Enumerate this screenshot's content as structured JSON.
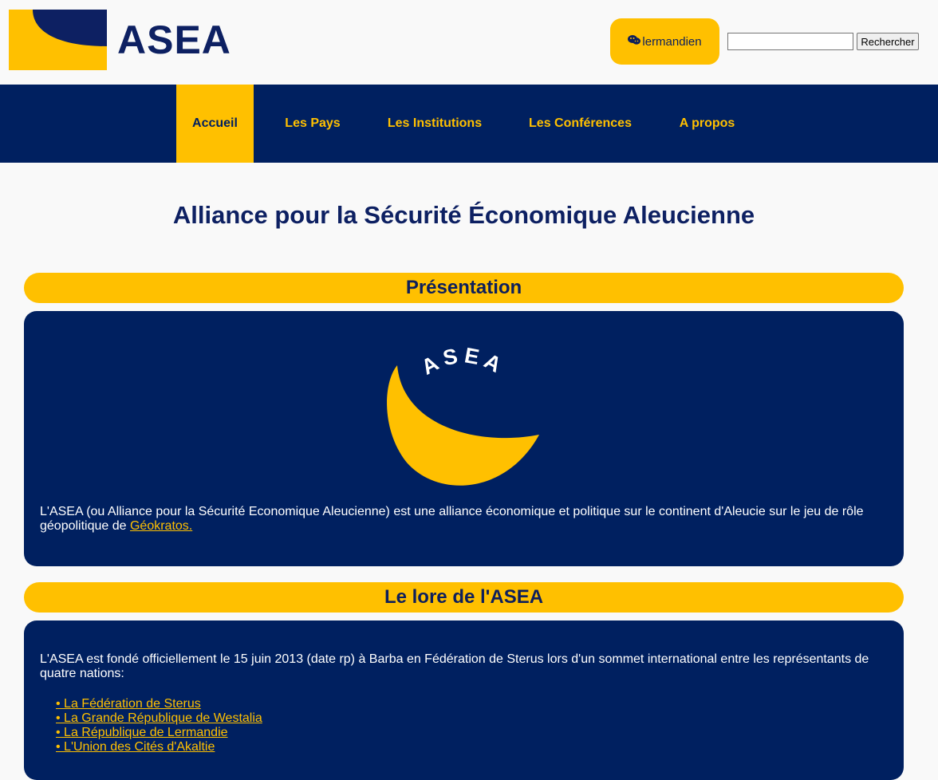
{
  "brand": {
    "name": "ASEA",
    "logo_colors": {
      "gold": "#ffc000",
      "navy": "#0d2062"
    }
  },
  "header": {
    "user": {
      "icon": "speech-bubbles-icon",
      "name": "lermandien"
    },
    "search": {
      "value": "",
      "button_label": "Rechercher"
    }
  },
  "nav": {
    "items": [
      {
        "label": "Accueil",
        "active": true
      },
      {
        "label": "Les Pays",
        "active": false
      },
      {
        "label": "Les Institutions",
        "active": false
      },
      {
        "label": "Les Conférences",
        "active": false
      },
      {
        "label": "A propos",
        "active": false
      }
    ]
  },
  "main": {
    "title": "Alliance pour la Sécurité Économique Aleucienne",
    "sections": [
      {
        "heading": "Présentation",
        "emblem_text": "ASEA",
        "text_before_link": "L'ASEA (ou Alliance pour la Sécurité Economique Aleucienne) est une alliance économique et politique sur le continent d'Aleucie sur le jeu de rôle géopolitique de ",
        "link": "Géokratos."
      },
      {
        "heading": "Le lore de l'ASEA",
        "intro": "L'ASEA est fondé officiellement le 15 juin 2013 (date rp) à Barba en Fédération de Sterus lors d'un sommet international entre les représentants de quatre nations:",
        "nations": [
          "• La Fédération de Sterus",
          "• La Grande République de Westalia",
          "• La République de Lermandie",
          "• L'Union des Cités d'Akaltie"
        ]
      }
    ]
  },
  "colors": {
    "navy": "#002060",
    "gold": "#ffc000",
    "background": "#f9f9f9",
    "text_dark": "#0d1f5c"
  }
}
